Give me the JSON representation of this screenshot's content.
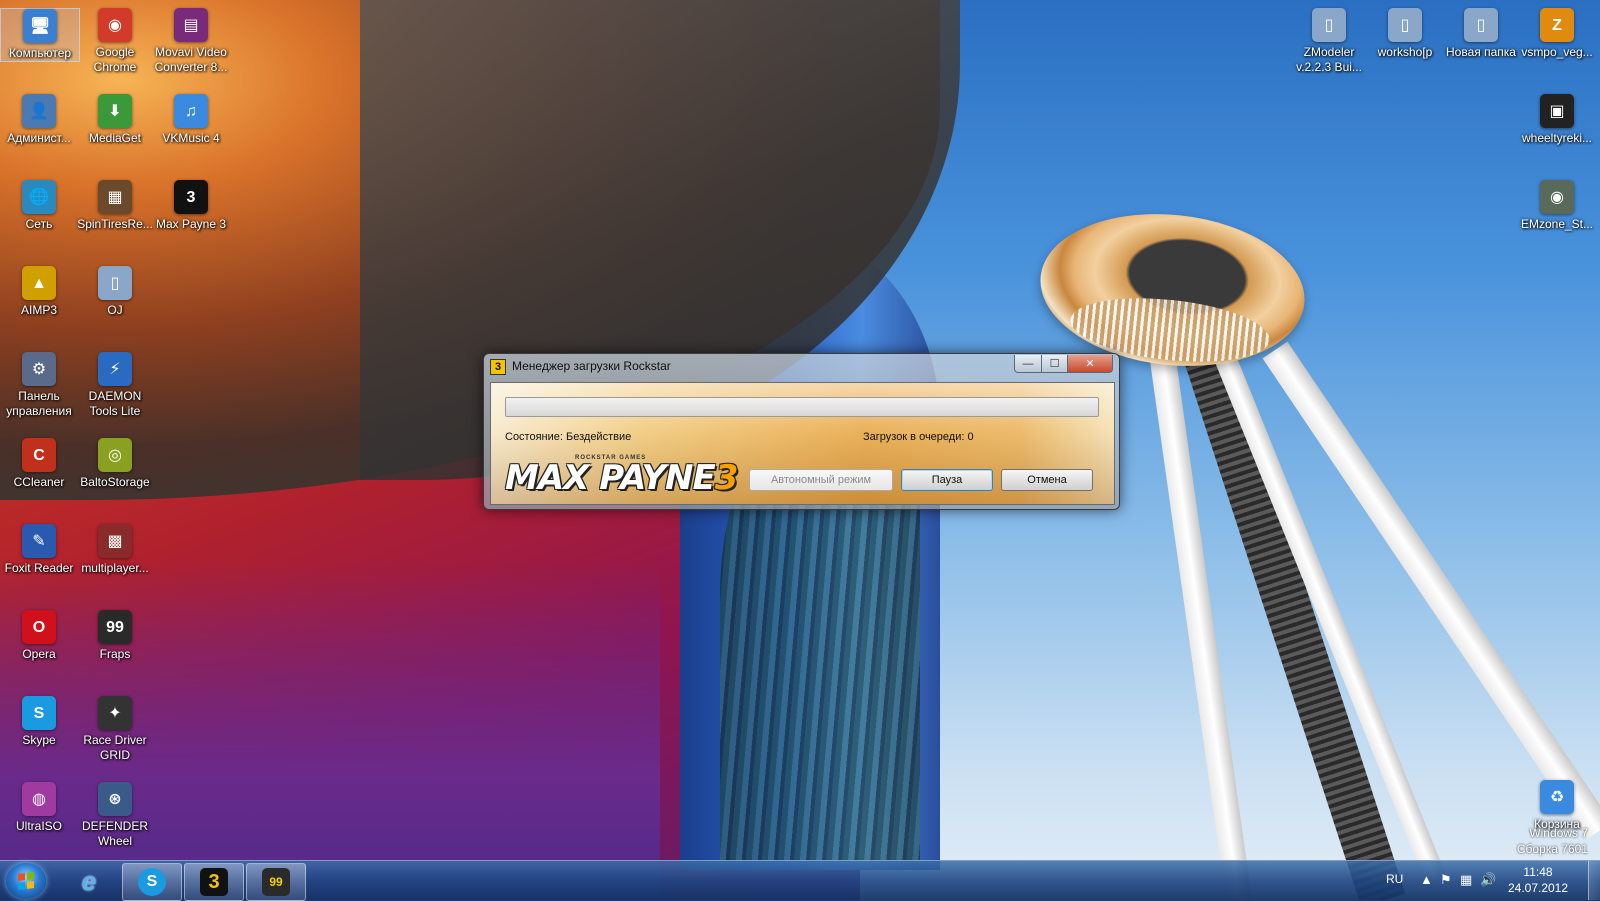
{
  "desktop": {
    "icons_left": [
      {
        "id": "computer",
        "label": "Компьютер",
        "glyph": "🖥",
        "color": "#3a7fd0"
      },
      {
        "id": "chrome",
        "label": "Google Chrome",
        "glyph": "◉",
        "color": "#d23a2a"
      },
      {
        "id": "movavi",
        "label": "Movavi Video Converter 8...",
        "glyph": "▤",
        "color": "#7a2a7a"
      },
      {
        "id": "admin",
        "label": "Админист...",
        "glyph": "👤",
        "color": "#4a7ab0"
      },
      {
        "id": "mediaget",
        "label": "MediaGet",
        "glyph": "⬇",
        "color": "#3a9a3a"
      },
      {
        "id": "vkmusic",
        "label": "VKMusic 4",
        "glyph": "♫",
        "color": "#3a8ae0"
      },
      {
        "id": "network",
        "label": "Сеть",
        "glyph": "🌐",
        "color": "#2a8ac0"
      },
      {
        "id": "spintires",
        "label": "SpinTiresRe...",
        "glyph": "▦",
        "color": "#6a4a2a"
      },
      {
        "id": "maxpayne",
        "label": "Max Payne 3",
        "glyph": "3",
        "color": "#111"
      },
      {
        "id": "aimp",
        "label": "AIMP3",
        "glyph": "▲",
        "color": "#d0a000"
      },
      {
        "id": "oj",
        "label": "OJ",
        "glyph": "▯",
        "color": "#8aa6c8"
      },
      {
        "id": "control",
        "label": "Панель управления",
        "glyph": "⚙",
        "color": "#5a6a8a"
      },
      {
        "id": "daemon",
        "label": "DAEMON Tools Lite",
        "glyph": "⚡",
        "color": "#2a6ac0"
      },
      {
        "id": "ccleaner",
        "label": "CCleaner",
        "glyph": "C",
        "color": "#c0301a"
      },
      {
        "id": "balto",
        "label": "BaltoStorage",
        "glyph": "◎",
        "color": "#8aa020"
      },
      {
        "id": "foxit",
        "label": "Foxit Reader",
        "glyph": "✎",
        "color": "#2a5ab0"
      },
      {
        "id": "multiplayer",
        "label": "multiplayer...",
        "glyph": "▩",
        "color": "#8a2a2a"
      },
      {
        "id": "opera",
        "label": "Opera",
        "glyph": "O",
        "color": "#d0101a"
      },
      {
        "id": "fraps",
        "label": "Fraps",
        "glyph": "99",
        "color": "#2a2a2a"
      },
      {
        "id": "skype",
        "label": "Skype",
        "glyph": "S",
        "color": "#1a9ae0"
      },
      {
        "id": "racedriver",
        "label": "Race Driver GRID",
        "glyph": "✦",
        "color": "#333"
      },
      {
        "id": "ultraiso",
        "label": "UltraISO",
        "glyph": "◍",
        "color": "#a03aa0"
      },
      {
        "id": "defender",
        "label": "DEFENDER Wheel",
        "glyph": "⊛",
        "color": "#3a5a8a"
      }
    ],
    "icons_right": [
      {
        "id": "zmodeler",
        "label": "ZModeler v.2.2.3 Bui...",
        "glyph": "▯",
        "color": "#8aa6c8"
      },
      {
        "id": "workshop",
        "label": "worksho[p",
        "glyph": "▯",
        "color": "#8aa6c8"
      },
      {
        "id": "newfolder",
        "label": "Новая папка",
        "glyph": "▯",
        "color": "#8aa6c8"
      },
      {
        "id": "vsmpo",
        "label": "vsmpo_veg...",
        "glyph": "Z",
        "color": "#e08a10"
      },
      {
        "id": "wheeltyreki",
        "label": "wheeltyreki...",
        "glyph": "▣",
        "color": "#222"
      },
      {
        "id": "emzone",
        "label": "EMzone_St...",
        "glyph": "◉",
        "color": "#5a6a5a"
      },
      {
        "id": "recycle",
        "label": "Корзина",
        "glyph": "♻",
        "color": "#3a8ae0"
      }
    ]
  },
  "dialog": {
    "title": "Менеджер загрузки Rockstar",
    "title_icon": "3",
    "progress": 0,
    "status_text": "Состояние: Бездействие",
    "queue_text": "Загрузок в очереди: 0",
    "logo_small": "ROCKSTAR GAMES",
    "logo_main": "MAX PAYNE",
    "logo_num": "3",
    "offline_label": "Автономный режим",
    "pause_label": "Пауза",
    "cancel_label": "Отмена",
    "min_glyph": "—",
    "max_glyph": "☐",
    "close_glyph": "✕"
  },
  "watermark": {
    "line1": "Windows 7",
    "line2": "Сборка 7601"
  },
  "taskbar": {
    "ie_glyph": "e",
    "skype_glyph": "S",
    "mp3_glyph": "3",
    "fraps_glyph": "99",
    "lang": "RU",
    "time": "11:48",
    "date": "24.07.2012"
  }
}
